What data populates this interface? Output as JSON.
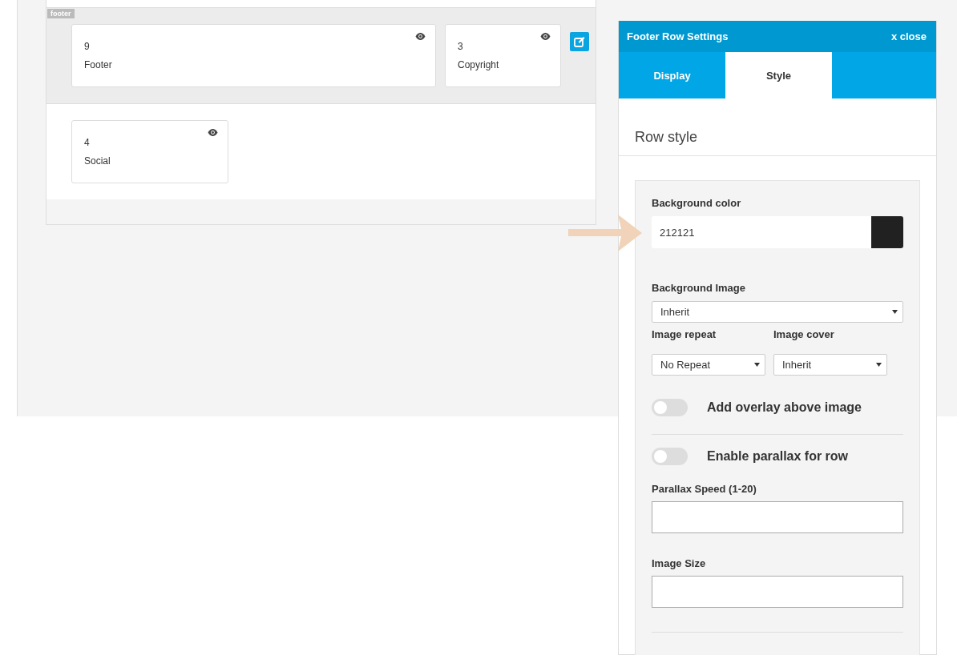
{
  "builder": {
    "rows": [
      {
        "label": "footer",
        "selected": true,
        "modules": [
          {
            "number": "9",
            "title": "Footer",
            "wide": true
          },
          {
            "number": "3",
            "title": "Copyright",
            "wide": false
          }
        ]
      },
      {
        "selected": false,
        "modules": [
          {
            "number": "4",
            "title": "Social",
            "wide": false
          }
        ]
      }
    ]
  },
  "settings_panel": {
    "title": "Footer Row Settings",
    "close": "x close",
    "tabs": [
      {
        "label": "Display",
        "selected": false
      },
      {
        "label": "Style",
        "selected": true
      }
    ],
    "section_title": "Row style",
    "fields": [
      {
        "kind": "color",
        "label": "Background color",
        "value": "212121",
        "color": "#212121"
      },
      {
        "kind": "select",
        "label": "Background Image",
        "value": "Inherit"
      },
      {
        "kind": "pair",
        "items": [
          {
            "label": "Image repeat",
            "value": "No Repeat"
          },
          {
            "label": "Image cover",
            "value": "Inherit"
          }
        ]
      },
      {
        "kind": "toggle",
        "label": "Add overlay above image",
        "on": false
      },
      {
        "kind": "rule"
      },
      {
        "kind": "toggle",
        "label": "Enable parallax for row",
        "on": false
      },
      {
        "kind": "text",
        "label": "Parallax Speed (1-20)"
      },
      {
        "kind": "text",
        "label": "Image Size"
      },
      {
        "kind": "rule"
      }
    ]
  }
}
